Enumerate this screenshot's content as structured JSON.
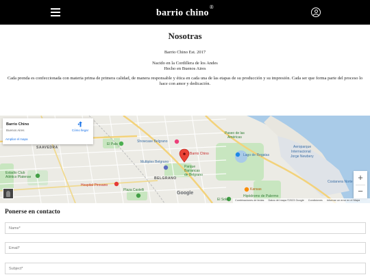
{
  "header": {
    "brand": "barrio chino",
    "brand_mark": "®",
    "menu_icon": "hamburger-menu-icon",
    "account_icon": "user-account-icon",
    "background": "#000000"
  },
  "about": {
    "title": "Nosotras",
    "established": "Barrio Chino Est. 2017",
    "origin_line1": "Nacido en la Cordillera de los Andes",
    "origin_line2": "Hecho en Buenos Aires",
    "description": "Cada prenda es confeccionada con materia prima de primera calidad, de manera responsable y ética en cada una de las etapas de su producción y su impresión. Cada ser que forma parte del proceso lo hace con amor y dedicación."
  },
  "map": {
    "card": {
      "place": "Barrio Chino",
      "city": "Buenos Aires",
      "directions": "Cómo llegar",
      "enlarge": "Ampliar el mapa"
    },
    "labels": {
      "pin": "Barrio Chino",
      "saavedra": "SAAVEDRA",
      "el_pala": "El Pala",
      "showcase": "Showcase Belgrano",
      "multiplex": "Multiplex Belgrano",
      "parque": "Parque",
      "barrancas1": "Barrancas",
      "barrancas2": "de Belgrano",
      "belgrano": "BELGRANO",
      "hospital": "Hospital Pirovano",
      "plaza": "Plaza Castelli",
      "paseo1": "Paseo de las",
      "paseo2": "Américas",
      "lago": "Lago de Regatas",
      "aero1": "Aeroparque",
      "aero2": "Internacional",
      "aero3": "Jorge Newbery",
      "costanera": "Costanera Norte",
      "kansas": "Kansas",
      "hipodromo": "Hipódromo de Palermo",
      "el_solar": "El Solar",
      "estadio1": "Estadio Club",
      "estadio2": "Atlético Platense"
    },
    "attribution": {
      "shortcuts": "Combinaciones de teclas",
      "data": "Datos del mapa ©2023 Google",
      "terms": "Condiciones",
      "report": "Informar un error en el Mapa"
    },
    "logo": "Google",
    "zoom_in": "+",
    "zoom_out": "−"
  },
  "contact": {
    "title": "Ponerse en contacto",
    "name_placeholder": "Name*",
    "email_placeholder": "Email*",
    "subject_placeholder": "Subject*"
  }
}
